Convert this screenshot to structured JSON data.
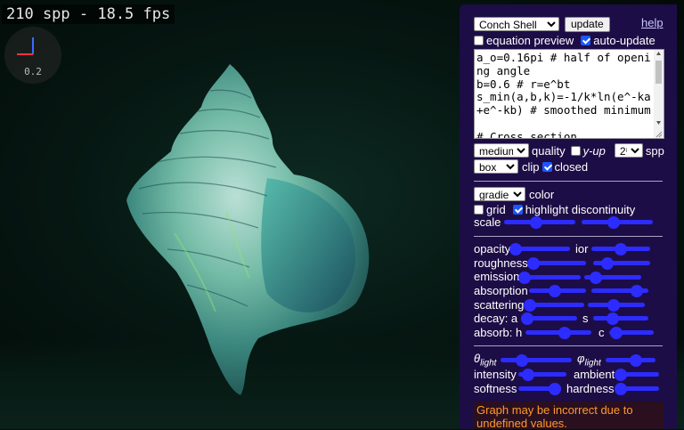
{
  "overlay": {
    "fps_text": "210 spp - 18.5 fps",
    "axes_value": "0.2"
  },
  "panel": {
    "preset_select": "Conch Shell",
    "update_button": "update",
    "help_link": "help",
    "equation_preview_label": "equation preview",
    "equation_preview_checked": false,
    "auto_update_label": "auto-update",
    "auto_update_checked": true,
    "code_text": "a_o=0.16pi # half of opening angle\nb=0.6 # r=e^bt\ns_min(a,b,k)=-1/k*ln(e^-ka+e^-kb) # smoothed minimum\n\n# Cross section",
    "quality_select": "medium",
    "quality_label": "quality",
    "y_up_label": "y-up",
    "y_up_checked": false,
    "spp_select": "2⁸",
    "spp_label": "spp",
    "clip_select": "box",
    "clip_label": "clip",
    "closed_label": "closed",
    "closed_checked": true,
    "color_select": "gradient",
    "color_label": "color",
    "grid_label": "grid",
    "grid_checked": false,
    "highlight_label": "highlight discontinuity",
    "highlight_checked": true,
    "scale_label": "scale",
    "opacity_label": "opacity",
    "ior_label": "ior",
    "roughness_label": "roughness",
    "emission_label": "emission",
    "absorption_label": "absorption",
    "scattering_label": "scattering",
    "decay_a_label": "decay: a",
    "decay_s_label": "s",
    "absorb_h_label": "absorb: h",
    "absorb_c_label": "c",
    "theta_symbol": "θ",
    "theta_sub": "light",
    "phi_symbol": "φ",
    "phi_sub": "light",
    "intensity_label": "intensity",
    "ambient_label": "ambient",
    "softness_label": "softness",
    "hardness_label": "hardness",
    "warning_text": "Graph may be incorrect due to undefined values.",
    "sliders": {
      "scale1": 0.45,
      "scale2": 0.45,
      "opacity": 0.05,
      "ior": 0.5,
      "roughness": 0.05,
      "roughness2": 0.25,
      "emission": 0.02,
      "emission2": 0.2,
      "absorption": 0.45,
      "absorption2": 0.8,
      "scattering": 0.05,
      "scattering2": 0.45,
      "decay_a": 0.1,
      "decay_s": 0.35,
      "absorb_h": 0.6,
      "absorb_c": 0.15,
      "theta": 0.3,
      "phi": 0.6,
      "intensity": 0.2,
      "ambient": 0.1,
      "softness": 0.85,
      "hardness": 0.1
    }
  },
  "colors": {
    "panel_bg": "#1d0d46",
    "slider_blue": "#2c2cff",
    "warning_text": "#ff9a2a"
  }
}
